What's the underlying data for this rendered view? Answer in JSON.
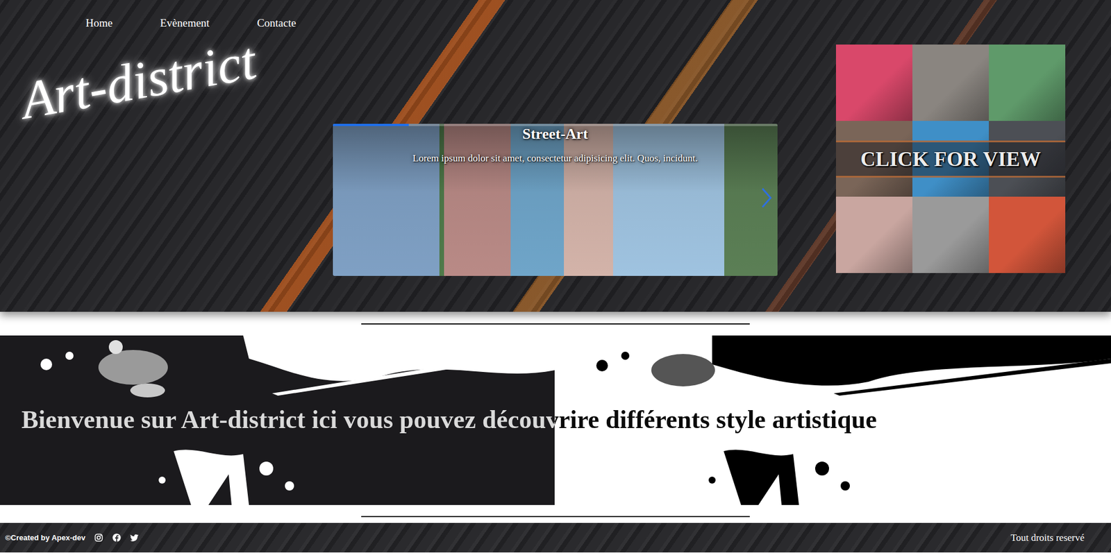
{
  "nav": [
    {
      "label": "Home"
    },
    {
      "label": "Evènement"
    },
    {
      "label": "Contacte"
    }
  ],
  "logo": "Art-district",
  "carousel": {
    "title": "Street-Art",
    "caption": "Lorem ipsum dolor sit amet, consectetur adipisicing elit. Quos, incidunt.",
    "progress": 0.17
  },
  "gallery": {
    "overlay": "CLICK FOR VIEW",
    "tiles": [
      {
        "color": "#d9486a"
      },
      {
        "color": "#8a8580"
      },
      {
        "color": "#5f9a6a"
      },
      {
        "color": "#7a6558"
      },
      {
        "color": "#3f8fc7"
      },
      {
        "color": "#4c4f55"
      },
      {
        "color": "#c9a6a0"
      },
      {
        "color": "#9a9a9a"
      },
      {
        "color": "#d2553a"
      }
    ]
  },
  "welcome": "Bienvenue sur Art-district ici vous pouvez découvrire différents style artistique",
  "footer": {
    "credit": "©Created by Apex-dev",
    "rights": "Tout droits reservé"
  }
}
